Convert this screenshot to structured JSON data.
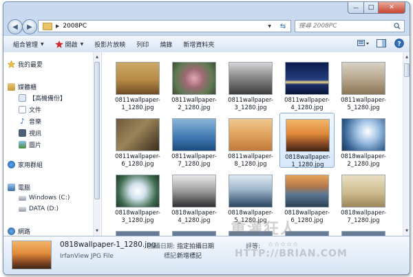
{
  "window": {
    "min_glyph": "—",
    "max_glyph": "□",
    "close_glyph": "✕"
  },
  "address_bar": {
    "path": "2008PC",
    "search_placeholder": "搜尋 2008PC"
  },
  "toolbar": {
    "organize": "組合管理",
    "open": "開啟",
    "slideshow": "投影片放映",
    "print": "列印",
    "burn": "燒錄",
    "new_folder": "新增資料夾"
  },
  "sidebar": {
    "favorites": "我的最愛",
    "libraries": "媒體櫃",
    "backup": "【高機備份】",
    "documents": "文件",
    "music": "音樂",
    "videos": "視訊",
    "pictures": "圖片",
    "homegroup": "家用群組",
    "computer": "電腦",
    "drive_c": "Windows (C:)",
    "drive_d": "DATA (D:)",
    "network": "網路"
  },
  "files": [
    {
      "line1": "0811wallpaper-",
      "line2": "1_1280.jpg",
      "icon": "tree-photo"
    },
    {
      "line1": "0811wallpaper-",
      "line2": "2_1280.jpg",
      "icon": "flower-photo"
    },
    {
      "line1": "0811wallpaper-",
      "line2": "3_1280.jpg",
      "icon": "city-photo"
    },
    {
      "line1": "0811wallpaper-",
      "line2": "4_1280.jpg",
      "icon": "night-sea-photo"
    },
    {
      "line1": "0811wallpaper-",
      "line2": "5_1280.jpg",
      "icon": "beach-photo"
    },
    {
      "line1": "0811wallpaper-",
      "line2": "6_1280.jpg",
      "icon": "creature-photo"
    },
    {
      "line1": "0811wallpaper-",
      "line2": "7_1280.jpg",
      "icon": "bird-photo"
    },
    {
      "line1": "0811wallpaper-",
      "line2": "8_1280.jpg",
      "icon": "figure-photo"
    },
    {
      "line1": "0818wallpaper-",
      "line2": "1_1280.jpg",
      "icon": "sunset-photo"
    },
    {
      "line1": "0818wallpaper-",
      "line2": "2_1280.jpg",
      "icon": "sky-photo"
    },
    {
      "line1": "0818wallpaper-",
      "line2": "3_1280.jpg",
      "icon": "white-flower-photo"
    },
    {
      "line1": "0818wallpaper-",
      "line2": "4_1280.jpg",
      "icon": "bw-landscape-photo"
    },
    {
      "line1": "0818wallpaper-",
      "line2": "5_1280.jpg",
      "icon": "clouds-photo"
    },
    {
      "line1": "0818wallpaper-",
      "line2": "6_1280.jpg",
      "icon": "lake-photo"
    },
    {
      "line1": "0818wallpaper-",
      "line2": "7_1280.jpg",
      "icon": "umbrella-photo"
    },
    {
      "line1": "",
      "line2": "",
      "icon": "partial-photo"
    },
    {
      "line1": "",
      "line2": "",
      "icon": "partial-photo"
    },
    {
      "line1": "",
      "line2": "",
      "icon": "partial-photo"
    },
    {
      "line1": "",
      "line2": "",
      "icon": "partial-photo"
    },
    {
      "line1": "",
      "line2": "",
      "icon": "partial-photo"
    }
  ],
  "selected_file": "0818wallpaper-1_1280.jpg",
  "details": {
    "filename": "0818wallpaper-1_1280.jpg",
    "filetype": "IrfanView JPG File",
    "date_label": "拍攝日期:",
    "date_value": "指定拍攝日期",
    "tags_label": "標記:",
    "tags_value": "新增標記",
    "rating_label": "評等:",
    "rating_stars": "☆☆☆☆☆"
  },
  "watermark": {
    "line1": "重灌狂人",
    "line2": "HTTP://BRIAN.COM"
  },
  "colors": {
    "window_frame": "#c9daf0",
    "selection": "#d7e8fb",
    "accent": "#2f6dbd"
  }
}
